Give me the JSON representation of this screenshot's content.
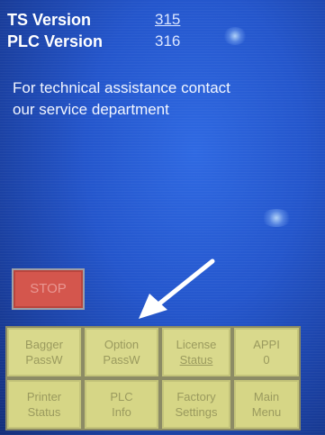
{
  "versions": {
    "ts_label": "TS Version",
    "ts_value": "315",
    "plc_label": "PLC Version",
    "plc_value": "316"
  },
  "assistance": {
    "line1": "For technical assistance contact",
    "line2": "our service department"
  },
  "stop_button": {
    "label": "STOP"
  },
  "menu": {
    "bagger_passw": {
      "line1": "Bagger",
      "line2": "PassW"
    },
    "option_passw": {
      "line1": "Option",
      "line2": "PassW"
    },
    "license_status": {
      "line1": "License",
      "line2": "Status"
    },
    "app1": {
      "line1": "APPI",
      "line2": "0"
    },
    "printer_status": {
      "line1": "Printer",
      "line2": "Status"
    },
    "plc_info": {
      "line1": "PLC",
      "line2": "Info"
    },
    "factory_settings": {
      "line1": "Factory",
      "line2": "Settings"
    },
    "main_menu": {
      "line1": "Main",
      "line2": "Menu"
    }
  },
  "colors": {
    "screen_blue": "#2456cc",
    "stop_red": "#d4564d",
    "button_yellow": "#d9d98c",
    "arrow_white": "#ffffff"
  }
}
